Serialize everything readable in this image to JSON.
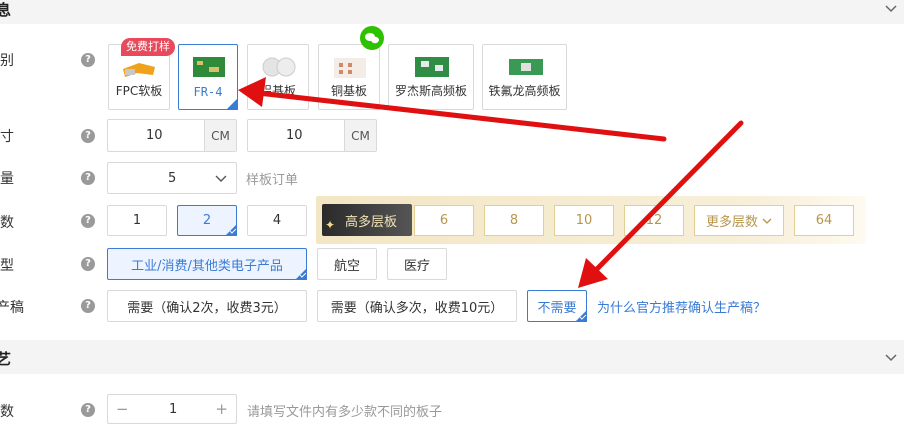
{
  "sections": {
    "top_title": "息",
    "bottom_title": "艺"
  },
  "rows": {
    "material_label": "别",
    "size_label": "寸",
    "quantity_label": "量",
    "layers_label": "数",
    "application_label": "型",
    "confirm_label": "产稿",
    "kinds_label": "数"
  },
  "materials": {
    "badge": "免费打样",
    "items": [
      "FPC软板",
      "FR-4",
      "铝基板",
      "铜基板",
      "罗杰斯高频板",
      "铁氟龙高频板"
    ]
  },
  "size": {
    "width": "10",
    "height": "10",
    "unit": "CM"
  },
  "quantity": {
    "value": "5",
    "hint": "样板订单"
  },
  "layers": {
    "options": [
      "1",
      "2",
      "4"
    ],
    "premium_label": "高多层板",
    "premium_options": [
      "6",
      "8",
      "10",
      "12"
    ],
    "more_label": "更多层数",
    "max": "64"
  },
  "application": {
    "options": [
      "工业/消费/其他类电子产品",
      "航空",
      "医疗"
    ]
  },
  "confirm": {
    "options": [
      "需要（确认2次，收费3元）",
      "需要（确认多次，收费10元）",
      "不需要"
    ],
    "link": "为什么官方推荐确认生产稿？"
  },
  "kinds": {
    "minus": "−",
    "value": "1",
    "plus": "+",
    "hint": "请填写文件内有多少款不同的板子"
  },
  "colors": {
    "accent": "#3a7bd5",
    "badge": "#e8495b",
    "gold": "#b7964c",
    "arrow": "#e01010",
    "wechat": "#2dc100"
  }
}
